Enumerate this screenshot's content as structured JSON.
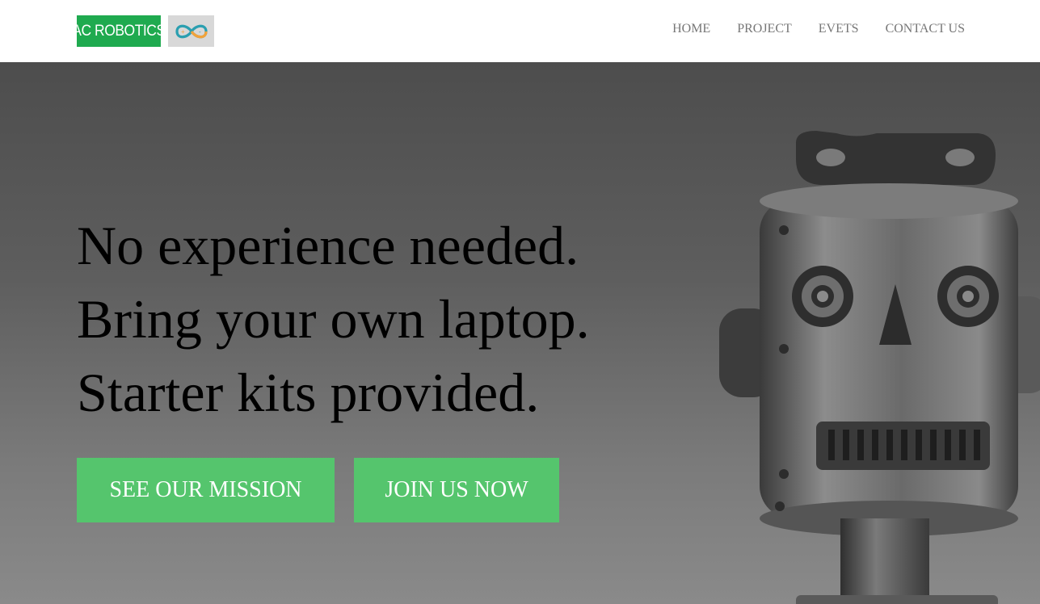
{
  "logo": {
    "text": "AC ROBOTICS",
    "mark_icon": "infinity-icon"
  },
  "nav": {
    "items": [
      {
        "label": "HOME"
      },
      {
        "label": "PROJECT"
      },
      {
        "label": "EVETS"
      },
      {
        "label": "CONTACT US"
      }
    ]
  },
  "hero": {
    "lines": [
      "No experience needed.",
      "Bring your own laptop.",
      "Starter kits provided."
    ],
    "buttons": {
      "mission": "SEE OUR MISSION",
      "join": "JOIN US NOW"
    },
    "image_icon": "robot-icon"
  },
  "colors": {
    "logo_green": "#1faa4f",
    "button_green": "#55c56d",
    "nav_text": "#777777",
    "hero_dark": "#4d4d4d",
    "hero_light": "#8a8a8a"
  }
}
